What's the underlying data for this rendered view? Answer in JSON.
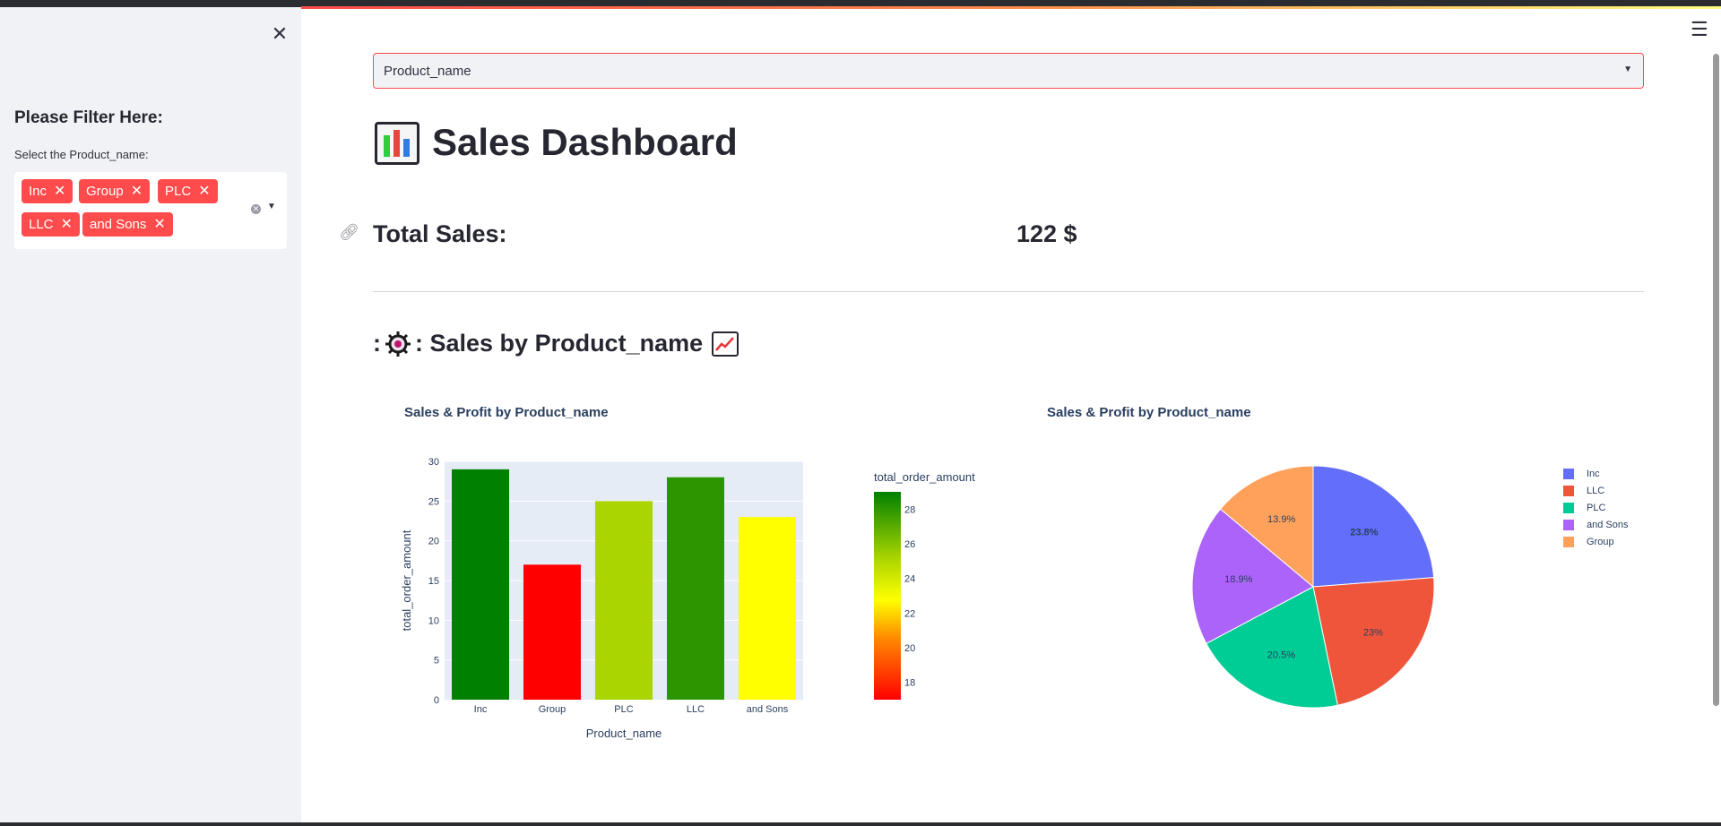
{
  "sidebar": {
    "filter_heading": "Please Filter Here:",
    "select_label": "Select the Product_name:",
    "selected_tags": [
      "Inc",
      "Group",
      "PLC",
      "LLC",
      "and Sons"
    ],
    "tag_color": "#ff4b4b"
  },
  "main": {
    "page_select_value": "Product_name",
    "title": "Sales Dashboard",
    "total_sales_label": "Total Sales:",
    "total_sales_value": "122 $",
    "section_heading_prefix": ":",
    "section_heading_text": ": Sales by Product_name"
  },
  "chart_data": [
    {
      "type": "bar",
      "title": "Sales & Profit by Product_name",
      "categories": [
        "Inc",
        "Group",
        "PLC",
        "LLC",
        "and Sons"
      ],
      "values": [
        29,
        17,
        25,
        28,
        23
      ],
      "xlabel": "Product_name",
      "ylabel": "total_order_amount",
      "ylim": [
        0,
        30
      ],
      "yticks": [
        0,
        5,
        10,
        15,
        20,
        25,
        30
      ],
      "colors": [
        "#008000",
        "#ff0000",
        "#aad500",
        "#2b9600",
        "#ffff00"
      ],
      "colorbar": {
        "title": "total_order_amount",
        "ticks": [
          18,
          20,
          22,
          24,
          26,
          28
        ],
        "range": [
          17,
          29
        ]
      },
      "background": "#e5ecf6"
    },
    {
      "type": "pie",
      "title": "Sales & Profit by Product_name",
      "labels": [
        "Inc",
        "LLC",
        "PLC",
        "and Sons",
        "Group"
      ],
      "values": [
        23.8,
        23,
        20.5,
        18.9,
        13.9
      ],
      "display_labels": [
        "23.8%",
        "23%",
        "20.5%",
        "18.9%",
        "13.9%"
      ],
      "colors": [
        "#636efa",
        "#ef553b",
        "#00cc96",
        "#ab63fa",
        "#ffa15a"
      ],
      "legend_position": "right"
    }
  ]
}
